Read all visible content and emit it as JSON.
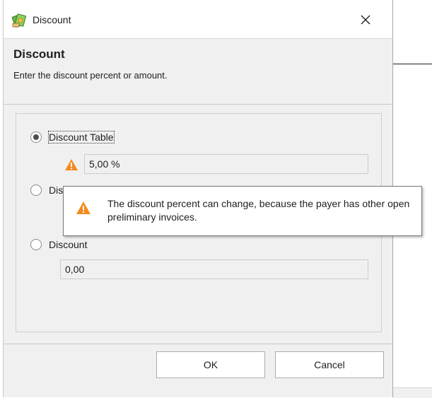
{
  "window": {
    "title": "Discount",
    "close_glyph": "✕",
    "icon": "money-icon"
  },
  "header": {
    "title": "Discount",
    "subtitle": "Enter the discount percent or amount."
  },
  "options": [
    {
      "label": "Discount Table",
      "selected": true,
      "value": "5,00 %",
      "warning_icon": "warning-icon"
    },
    {
      "label": "Dis",
      "selected": false
    },
    {
      "label": "Discount",
      "selected": false,
      "value": "0,00"
    }
  ],
  "tooltip": {
    "icon": "warning-icon",
    "text": "The discount percent can change, because the payer has other open preliminary invoices."
  },
  "buttons": {
    "ok": "OK",
    "cancel": "Cancel"
  },
  "colors": {
    "warning": "#f28c1e",
    "dialog_bg": "#f0f0f0"
  }
}
